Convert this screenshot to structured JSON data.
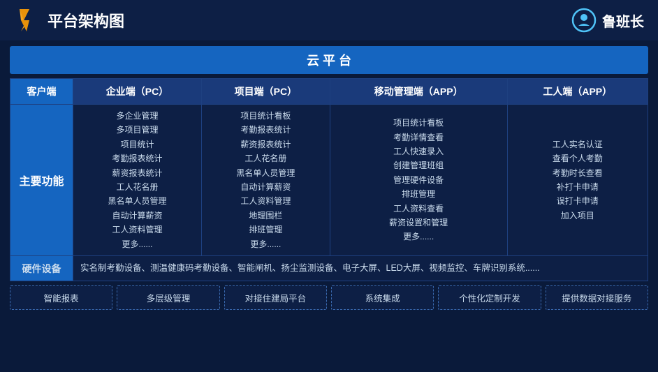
{
  "header": {
    "title": "平台架构图",
    "brand": "鲁班长"
  },
  "cloud_platform": "云 平 台",
  "columns": [
    {
      "label": "客户端",
      "key": "client"
    },
    {
      "label": "企业端（PC）",
      "key": "enterprise"
    },
    {
      "label": "项目端（PC）",
      "key": "project"
    },
    {
      "label": "移动管理端（APP）",
      "key": "mobile"
    },
    {
      "label": "工人端（APP）",
      "key": "worker"
    }
  ],
  "rows": {
    "main_func": {
      "label": "主要功能",
      "enterprise": [
        "多企业管理",
        "多项目管理",
        "项目统计",
        "考勤报表统计",
        "薪资报表统计",
        "工人花名册",
        "黑名单人员管理",
        "自动计算薪资",
        "工人资料管理",
        "更多......"
      ],
      "project": [
        "项目统计看板",
        "考勤报表统计",
        "薪资报表统计",
        "工人花名册",
        "黑名单人员管理",
        "自动计算薪资",
        "工人资料管理",
        "地理围栏",
        "排班管理",
        "更多......"
      ],
      "mobile": [
        "项目统计看板",
        "考勤详情查看",
        "工人快速录入",
        "创建管理班组",
        "管理硬件设备",
        "排班管理",
        "工人资料查看",
        "薪资设置和管理",
        "更多......"
      ],
      "worker": [
        "工人实名认证",
        "查看个人考勤",
        "考勤时长查看",
        "补打卡申请",
        "误打卡申请",
        "加入项目"
      ]
    },
    "hardware": {
      "label": "硬件设备",
      "desc": "实名制考勤设备、测温健康码考勤设备、智能闸机、扬尘监测设备、电子大屏、LED大屏、视频监控、车牌识别系统......"
    }
  },
  "bottom_features": [
    "智能报表",
    "多层级管理",
    "对接住建局平台",
    "系统集成",
    "个性化定制开发",
    "提供数据对接服务"
  ]
}
